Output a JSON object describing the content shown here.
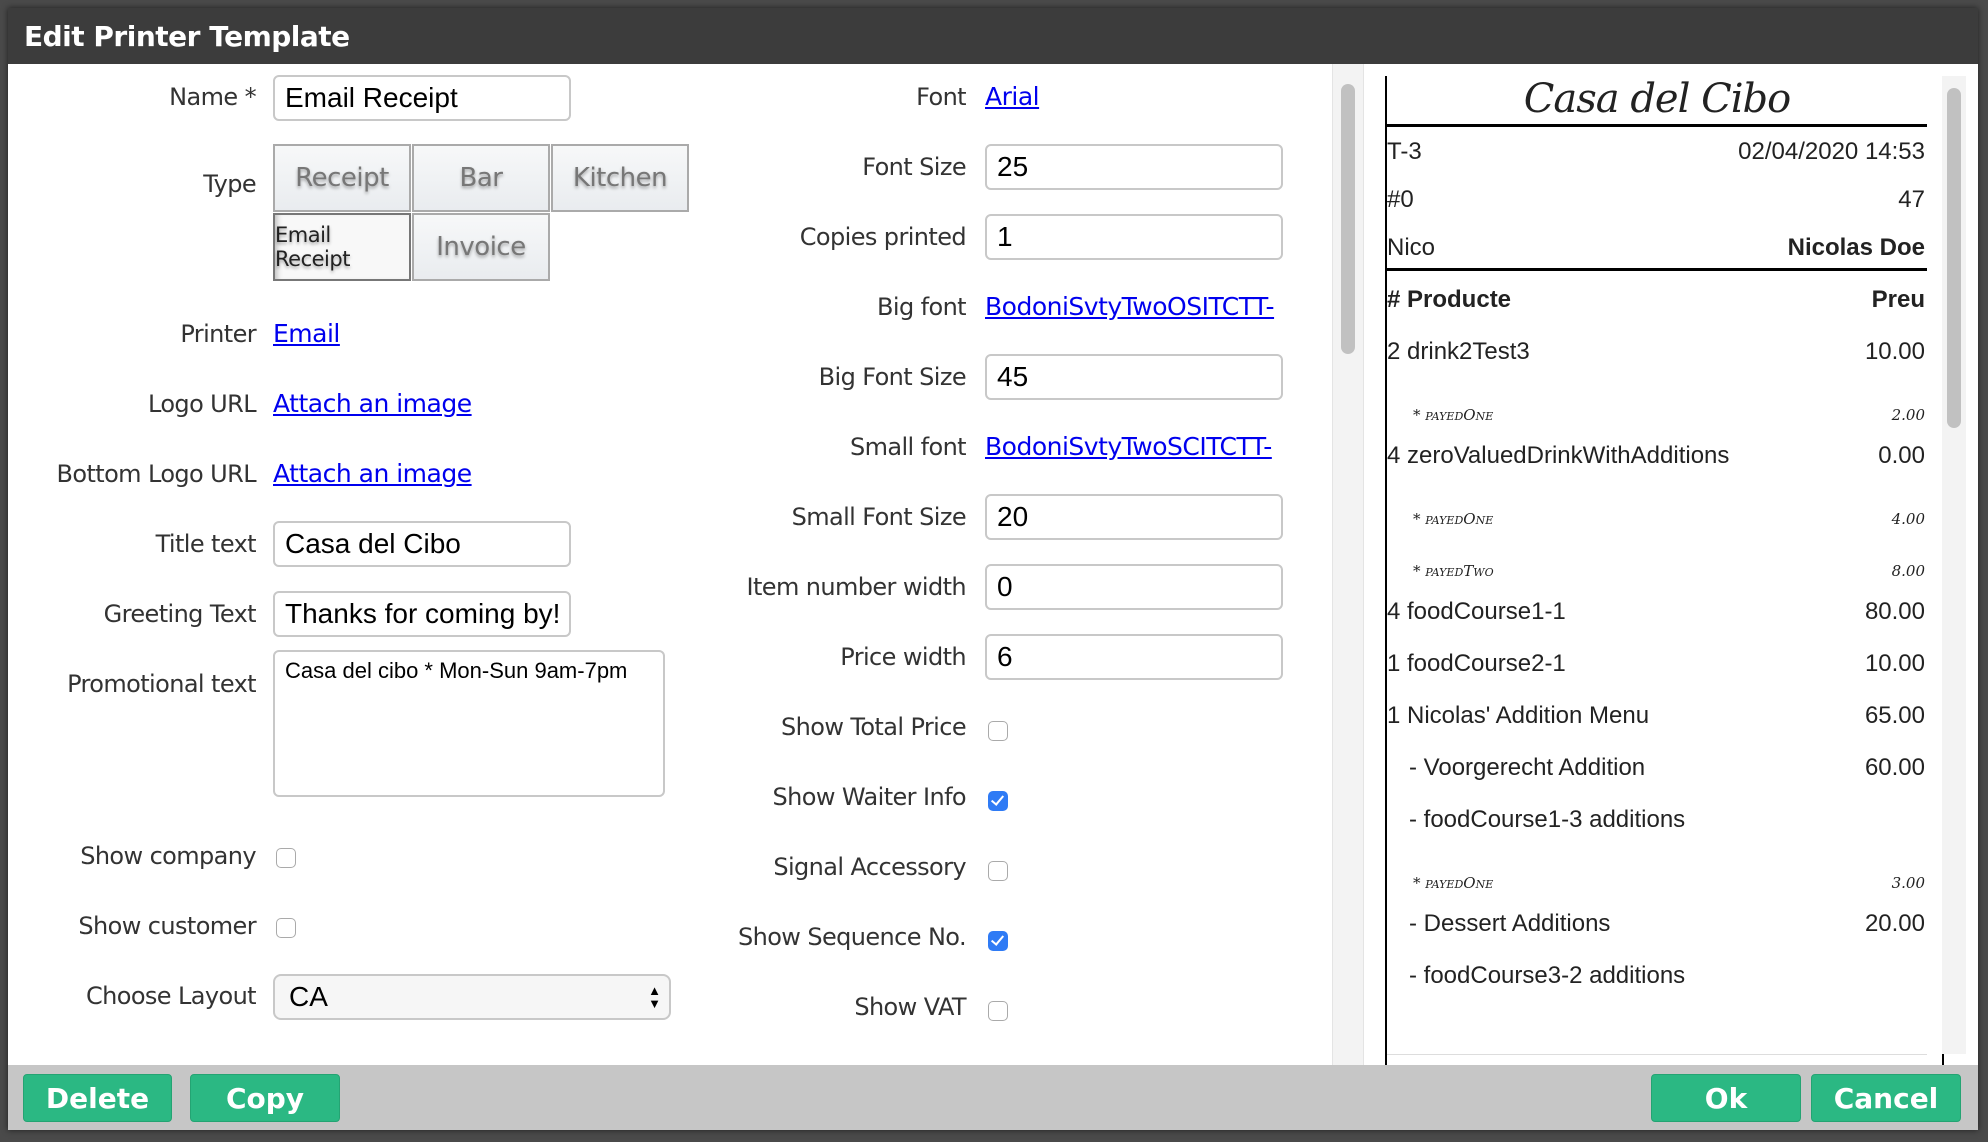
{
  "dialog": {
    "title": "Edit Printer Template"
  },
  "left": {
    "name": {
      "label": "Name *",
      "value": "Email Receipt"
    },
    "type": {
      "label": "Type",
      "options": [
        "Receipt",
        "Bar",
        "Kitchen",
        "Email Receipt",
        "Invoice"
      ],
      "selected": "Email Receipt"
    },
    "printer": {
      "label": "Printer",
      "value": "Email"
    },
    "logo_url": {
      "label": "Logo URL",
      "link": "Attach an image"
    },
    "bottom_logo_url": {
      "label": "Bottom Logo URL",
      "link": "Attach an image"
    },
    "title_text": {
      "label": "Title text",
      "value": "Casa del Cibo"
    },
    "greeting_text": {
      "label": "Greeting Text",
      "value": "Thanks for coming by!"
    },
    "promotional_text": {
      "label": "Promotional text",
      "value": "Casa del cibo * Mon-Sun 9am-7pm"
    },
    "show_company": {
      "label": "Show company",
      "checked": false
    },
    "show_customer": {
      "label": "Show customer",
      "checked": false
    },
    "choose_layout": {
      "label": "Choose Layout",
      "value": "CA"
    }
  },
  "middle": {
    "font": {
      "label": "Font",
      "value": "Arial"
    },
    "font_size": {
      "label": "Font Size",
      "value": "25"
    },
    "copies_printed": {
      "label": "Copies printed",
      "value": "1"
    },
    "big_font": {
      "label": "Big font",
      "value": "BodoniSvtyTwoOSITCTT-"
    },
    "big_font_size": {
      "label": "Big Font Size",
      "value": "45"
    },
    "small_font": {
      "label": "Small font",
      "value": "BodoniSvtyTwoSCITCTT-"
    },
    "small_font_size": {
      "label": "Small Font Size",
      "value": "20"
    },
    "item_number_width": {
      "label": "Item number width",
      "value": "0"
    },
    "price_width": {
      "label": "Price width",
      "value": "6"
    },
    "show_total_price": {
      "label": "Show Total Price",
      "checked": false
    },
    "show_waiter_info": {
      "label": "Show Waiter Info",
      "checked": true
    },
    "signal_accessory": {
      "label": "Signal Accessory",
      "checked": false
    },
    "show_sequence_no": {
      "label": "Show Sequence No.",
      "checked": true
    },
    "show_vat": {
      "label": "Show VAT",
      "checked": false
    }
  },
  "receipt": {
    "title": "Casa del Cibo",
    "table": "T-3",
    "datetime": "02/04/2020 14:53",
    "order_no": "#0",
    "sequence": "47",
    "waiter_short": "Nico",
    "waiter_full": "Nicolas Doe",
    "header": {
      "left": "# Producte",
      "right": "Preu"
    },
    "lines": [
      {
        "kind": "item",
        "text": "2 drink2Test3",
        "price": "10.00"
      },
      {
        "kind": "sub",
        "text": "* payedOne",
        "price": "2.00"
      },
      {
        "kind": "item",
        "text": "4 zeroValuedDrinkWithAdditions",
        "price": "0.00"
      },
      {
        "kind": "sub",
        "text": "* payedOne",
        "price": "4.00"
      },
      {
        "kind": "sub",
        "text": "* payedTwo",
        "price": "8.00"
      },
      {
        "kind": "item",
        "text": "4 foodCourse1-1",
        "price": "80.00"
      },
      {
        "kind": "item",
        "text": "1 foodCourse2-1",
        "price": "10.00"
      },
      {
        "kind": "item",
        "text": "1 Nicolas' Addition Menu",
        "price": "65.00"
      },
      {
        "kind": "indent",
        "text": "- Voorgerecht Addition",
        "price": "60.00"
      },
      {
        "kind": "indent",
        "text": "- foodCourse1-3 additions",
        "price": ""
      },
      {
        "kind": "sub",
        "text": "* payedOne",
        "price": "3.00"
      },
      {
        "kind": "indent",
        "text": "- Dessert Additions",
        "price": "20.00"
      },
      {
        "kind": "indent",
        "text": "- foodCourse3-2 additions",
        "price": ""
      }
    ]
  },
  "footer": {
    "delete": "Delete",
    "copy": "Copy",
    "ok": "Ok",
    "cancel": "Cancel"
  },
  "colors": {
    "button_green": "#2bb883",
    "checkbox_blue": "#2f7bf5",
    "link_blue": "#0000ee",
    "titlebar": "#3c3c3c",
    "footer": "#c6c6c6"
  }
}
